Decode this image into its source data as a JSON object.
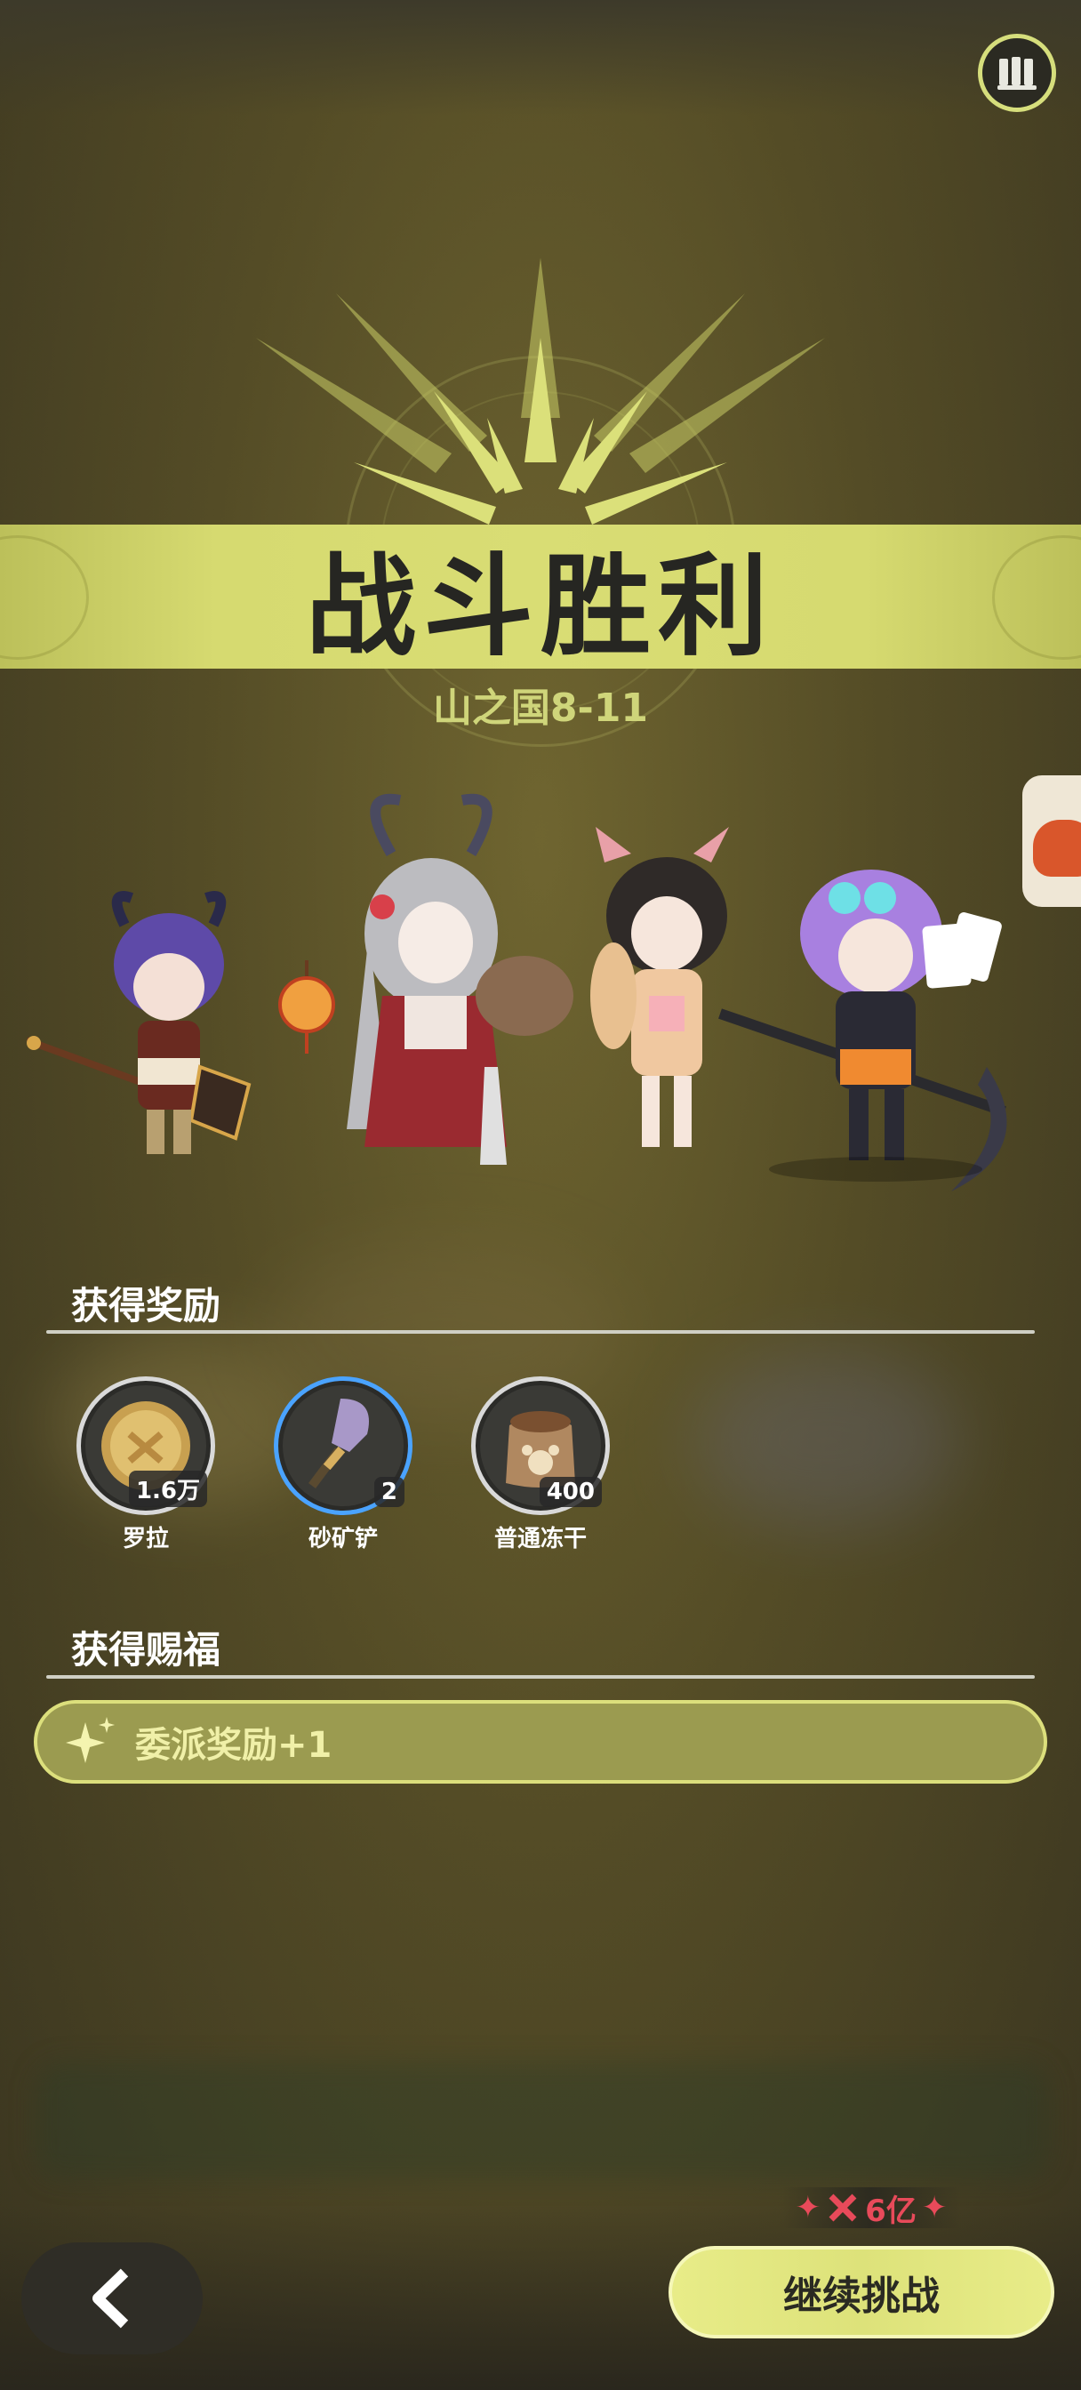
{
  "header": {
    "book_icon": "book-stack-icon"
  },
  "result": {
    "title": "战斗胜利",
    "stage": "山之国8-11"
  },
  "party": {
    "characters": [
      {
        "id": "char-1",
        "desc": "purple-haired ox-horn warrior"
      },
      {
        "id": "char-2",
        "desc": "silver-haired dragon-horn swordswoman"
      },
      {
        "id": "char-3",
        "desc": "dark-haired fox-ear girl"
      },
      {
        "id": "char-4",
        "desc": "lavender-haired scythe girl"
      }
    ]
  },
  "rewards": {
    "heading": "获得奖励",
    "items": [
      {
        "name": "罗拉",
        "count": "1.6万",
        "icon": "gold-coin-icon"
      },
      {
        "name": "砂矿铲",
        "count": "2",
        "icon": "shovel-icon"
      },
      {
        "name": "普通冻干",
        "count": "400",
        "icon": "food-bag-icon"
      }
    ]
  },
  "blessings": {
    "heading": "获得赐福",
    "items": [
      {
        "label": "委派奖励+1",
        "icon": "sparkle-icon"
      }
    ]
  },
  "footer": {
    "back_icon": "chevron-left-icon",
    "cost_value": "6亿",
    "continue_label": "继续挑战"
  },
  "colors": {
    "accent": "#d6da70",
    "banner_text": "#262622",
    "blessing_bg": "#9b9b50",
    "cost": "#e84a5a"
  }
}
